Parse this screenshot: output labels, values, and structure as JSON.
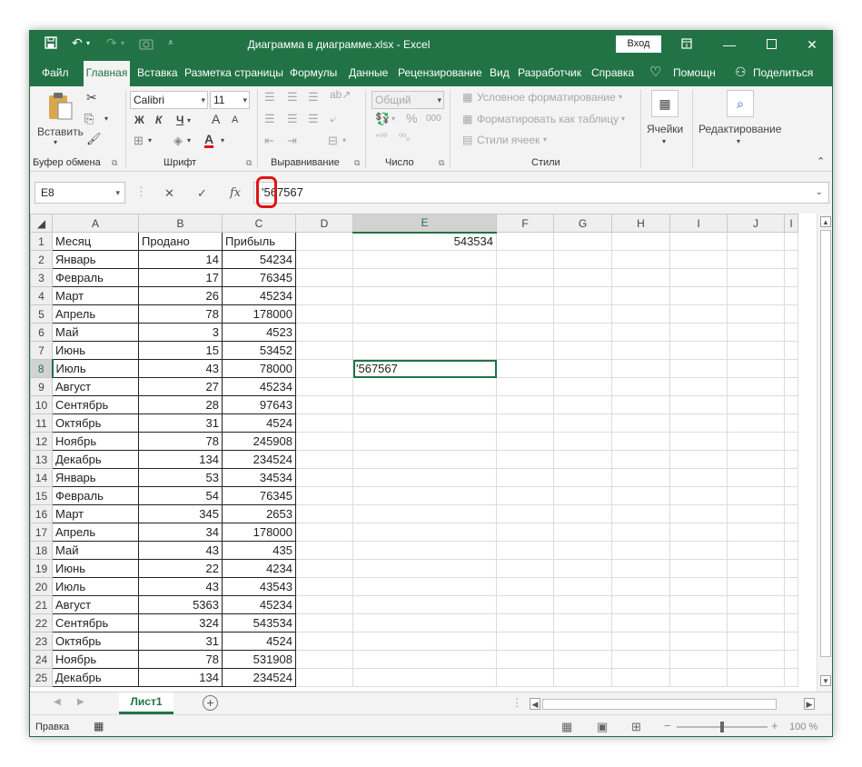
{
  "window": {
    "title": "Диаграмма в диаграмме.xlsx  -  Excel",
    "signin_label": "Вход"
  },
  "tabs": [
    "Файл",
    "Главная",
    "Вставка",
    "Разметка страницы",
    "Формулы",
    "Данные",
    "Рецензирование",
    "Вид",
    "Разработчик",
    "Справка",
    "Помощн",
    "Поделиться"
  ],
  "ribbon": {
    "clipboard": {
      "paste_label": "Вставить",
      "group_label": "Буфер обмена"
    },
    "font": {
      "name": "Calibri",
      "size": "11",
      "bold": "Ж",
      "italic": "К",
      "underline": "Ч",
      "grow": "A",
      "shrink": "A",
      "group_label": "Шрифт"
    },
    "alignment": {
      "group_label": "Выравнивание"
    },
    "number": {
      "format": "Общий",
      "group_label": "Число"
    },
    "styles": {
      "conditional": "Условное форматирование",
      "as_table": "Форматировать как таблицу",
      "cell_styles": "Стили ячеек",
      "group_label": "Стили"
    },
    "cells": {
      "label": "Ячейки"
    },
    "editing": {
      "label": "Редактирование"
    }
  },
  "formula_bar": {
    "name_box": "E8",
    "formula": "'567567"
  },
  "grid": {
    "columns": [
      "A",
      "B",
      "C",
      "D",
      "E",
      "F",
      "G",
      "H",
      "I",
      "J"
    ],
    "selected_column": "E",
    "selected_row": "8",
    "headers": [
      "Месяц",
      "Продано",
      "Прибыль"
    ],
    "rows": [
      {
        "n": "2",
        "month": "Январь",
        "sold": "14",
        "profit": "54234"
      },
      {
        "n": "3",
        "month": "Февраль",
        "sold": "17",
        "profit": "76345"
      },
      {
        "n": "4",
        "month": "Март",
        "sold": "26",
        "profit": "45234"
      },
      {
        "n": "5",
        "month": "Апрель",
        "sold": "78",
        "profit": "178000"
      },
      {
        "n": "6",
        "month": "Май",
        "sold": "3",
        "profit": "4523"
      },
      {
        "n": "7",
        "month": "Июнь",
        "sold": "15",
        "profit": "53452"
      },
      {
        "n": "8",
        "month": "Июль",
        "sold": "43",
        "profit": "78000"
      },
      {
        "n": "9",
        "month": "Август",
        "sold": "27",
        "profit": "45234"
      },
      {
        "n": "10",
        "month": "Сентябрь",
        "sold": "28",
        "profit": "97643"
      },
      {
        "n": "11",
        "month": "Октябрь",
        "sold": "31",
        "profit": "4524"
      },
      {
        "n": "12",
        "month": "Ноябрь",
        "sold": "78",
        "profit": "245908"
      },
      {
        "n": "13",
        "month": "Декабрь",
        "sold": "134",
        "profit": "234524"
      },
      {
        "n": "14",
        "month": "Январь",
        "sold": "53",
        "profit": "34534"
      },
      {
        "n": "15",
        "month": "Февраль",
        "sold": "54",
        "profit": "76345"
      },
      {
        "n": "16",
        "month": "Март",
        "sold": "345",
        "profit": "2653"
      },
      {
        "n": "17",
        "month": "Апрель",
        "sold": "34",
        "profit": "178000"
      },
      {
        "n": "18",
        "month": "Май",
        "sold": "43",
        "profit": "435"
      },
      {
        "n": "19",
        "month": "Июнь",
        "sold": "22",
        "profit": "4234"
      },
      {
        "n": "20",
        "month": "Июль",
        "sold": "43",
        "profit": "43543"
      },
      {
        "n": "21",
        "month": "Август",
        "sold": "5363",
        "profit": "45234"
      },
      {
        "n": "22",
        "month": "Сентябрь",
        "sold": "324",
        "profit": "543534"
      },
      {
        "n": "23",
        "month": "Октябрь",
        "sold": "31",
        "profit": "4524"
      },
      {
        "n": "24",
        "month": "Ноябрь",
        "sold": "78",
        "profit": "531908"
      },
      {
        "n": "25",
        "month": "Декабрь",
        "sold": "134",
        "profit": "234524"
      }
    ],
    "e1": "543534",
    "e8": "'567567"
  },
  "sheets": [
    "Лист1"
  ],
  "status": {
    "mode": "Правка",
    "zoom": "100 %"
  },
  "colors": {
    "accent": "#217346",
    "highlight_ring": "#e01414"
  }
}
